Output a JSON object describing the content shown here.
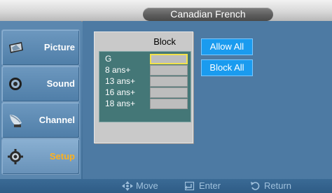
{
  "header": {
    "title": "Canadian French"
  },
  "sidebar": {
    "items": [
      {
        "label": "Picture",
        "icon": "picture-icon"
      },
      {
        "label": "Sound",
        "icon": "speaker-icon"
      },
      {
        "label": "Channel",
        "icon": "satellite-dish-icon"
      },
      {
        "label": "Setup",
        "icon": "gear-icon"
      }
    ],
    "active": "Setup"
  },
  "block_panel": {
    "header": "Block",
    "ratings": [
      {
        "label": "G",
        "selected": true
      },
      {
        "label": "8 ans+"
      },
      {
        "label": "13 ans+"
      },
      {
        "label": "16 ans+"
      },
      {
        "label": "18 ans+"
      }
    ]
  },
  "actions": {
    "allow_all": "Allow All",
    "block_all": "Block All"
  },
  "footer": {
    "move": "Move",
    "enter": "Enter",
    "return": "Return"
  },
  "colors": {
    "accent_blue": "#1a9bef",
    "active_label": "#ffb11c",
    "selection_yellow": "#f3e14a",
    "rating_list_bg": "#447777"
  }
}
